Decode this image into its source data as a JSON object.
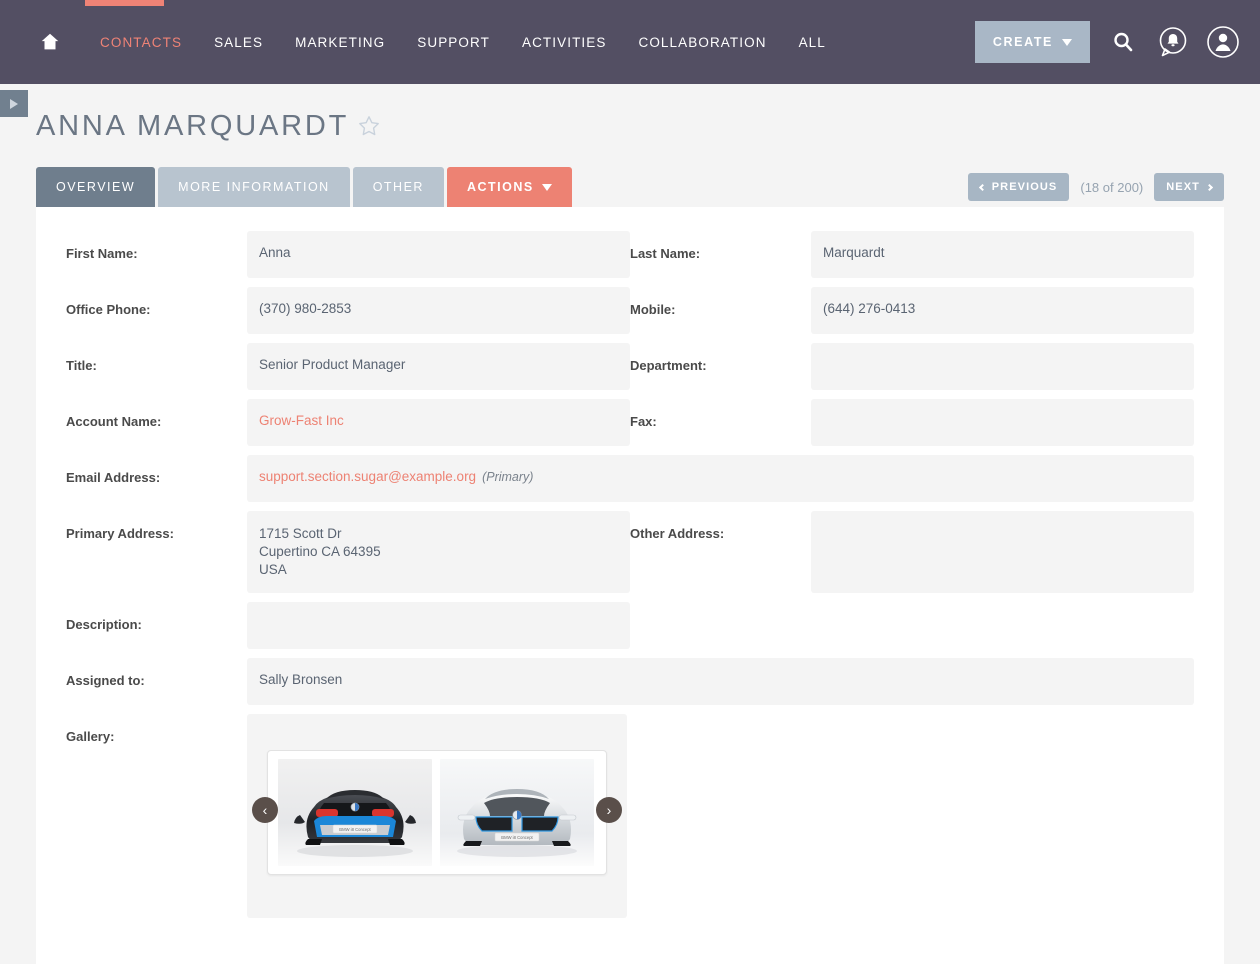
{
  "topnav": {
    "home_icon": "home-icon",
    "links": [
      {
        "label": "CONTACTS",
        "active": true
      },
      {
        "label": "SALES",
        "active": false
      },
      {
        "label": "MARKETING",
        "active": false
      },
      {
        "label": "SUPPORT",
        "active": false
      },
      {
        "label": "ACTIVITIES",
        "active": false
      },
      {
        "label": "COLLABORATION",
        "active": false
      },
      {
        "label": "ALL",
        "active": false
      }
    ],
    "create_label": "CREATE",
    "search_icon": "search-icon",
    "notifications_icon": "notification-bell-icon",
    "profile_icon": "user-avatar-icon",
    "accent_color": "#ef8376",
    "bar_color": "#534f63"
  },
  "sidebar_toggle": {
    "icon": "expand-sidebar-triangle-icon"
  },
  "record": {
    "title": "ANNA MARQUARDT",
    "favorite_icon": "star-outline-icon"
  },
  "tabs": [
    {
      "label": "OVERVIEW",
      "active": true
    },
    {
      "label": "MORE INFORMATION",
      "active": false
    },
    {
      "label": "OTHER",
      "active": false
    }
  ],
  "actions_button": {
    "label": "ACTIONS",
    "color": "#ed8273"
  },
  "pagination": {
    "previous_label": "PREVIOUS",
    "next_label": "NEXT",
    "count_text": "(18 of 200)"
  },
  "fields": {
    "first_name": {
      "label": "First Name:",
      "value": "Anna"
    },
    "last_name": {
      "label": "Last Name:",
      "value": "Marquardt"
    },
    "office_phone": {
      "label": "Office Phone:",
      "value": "(370) 980-2853"
    },
    "mobile": {
      "label": "Mobile:",
      "value": "(644) 276-0413"
    },
    "title": {
      "label": "Title:",
      "value": "Senior Product Manager"
    },
    "department": {
      "label": "Department:",
      "value": ""
    },
    "account_name": {
      "label": "Account Name:",
      "value": "Grow-Fast Inc"
    },
    "fax": {
      "label": "Fax:",
      "value": ""
    },
    "email_address": {
      "label": "Email Address:",
      "value": "support.section.sugar@example.org",
      "tag": "(Primary)"
    },
    "primary_address": {
      "label": "Primary Address:",
      "line1": "1715 Scott Dr",
      "line2": "Cupertino CA  64395",
      "line3": "USA"
    },
    "other_address": {
      "label": "Other Address:",
      "value": ""
    },
    "description": {
      "label": "Description:",
      "value": ""
    },
    "assigned_to": {
      "label": "Assigned to:",
      "value": "Sally Bronsen"
    },
    "gallery": {
      "label": "Gallery:"
    }
  },
  "gallery": {
    "prev_icon": "chevron-left-icon",
    "next_icon": "chevron-right-icon",
    "images": [
      {
        "name": "bmw-i8-concept-rear-black",
        "plate": "BMW i8 Concept"
      },
      {
        "name": "bmw-i8-concept-front-silver",
        "plate": "BMW i8 Concept"
      }
    ]
  }
}
